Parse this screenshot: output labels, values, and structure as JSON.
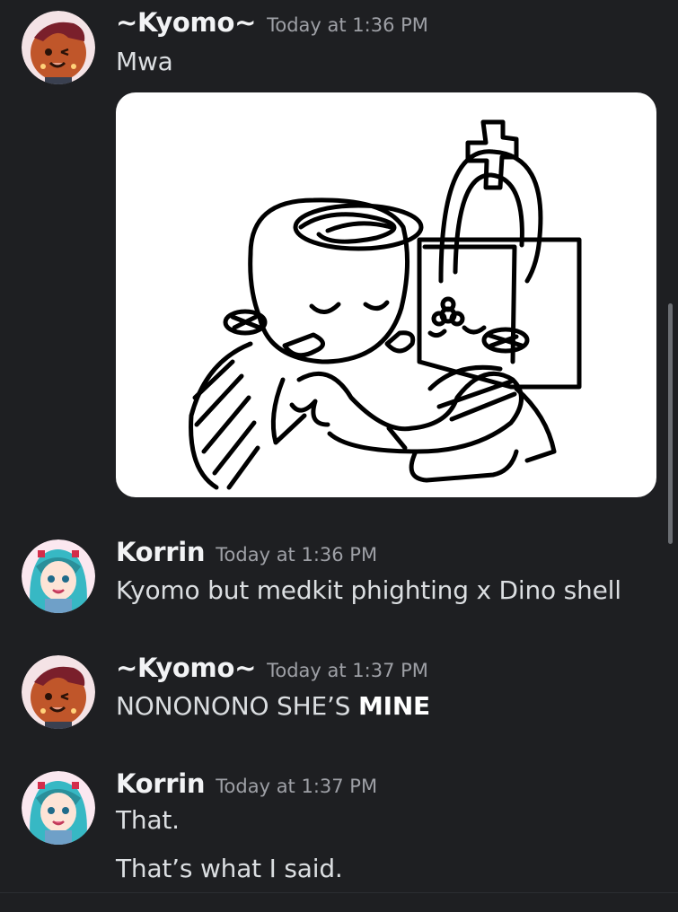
{
  "messages": [
    {
      "username": "~Kyomo~",
      "timestamp": "Today at 1:36 PM",
      "avatar_icon": "kyomo-cookie-avatar",
      "lines": [
        "Mwa"
      ],
      "attachment": "drawing-attachment"
    },
    {
      "username": "Korrin",
      "timestamp": "Today at 1:36 PM",
      "avatar_icon": "teal-haired-girl-avatar",
      "lines": [
        "Kyomo but medkit phighting x Dino shell"
      ]
    },
    {
      "username": "~Kyomo~",
      "timestamp": "Today at 1:37 PM",
      "avatar_icon": "kyomo-cookie-avatar",
      "text_plain": "NONONONO SHE’S ",
      "text_bold": "MINE"
    },
    {
      "username": "Korrin",
      "timestamp": "Today at 1:37 PM",
      "avatar_icon": "teal-haired-girl-avatar",
      "lines": [
        "That.",
        "That’s what I said."
      ]
    }
  ],
  "colors": {
    "background": "#1e1f22",
    "username": "#f2f3f5",
    "timestamp": "#9ea0a6",
    "message_text": "#dbdee1"
  }
}
